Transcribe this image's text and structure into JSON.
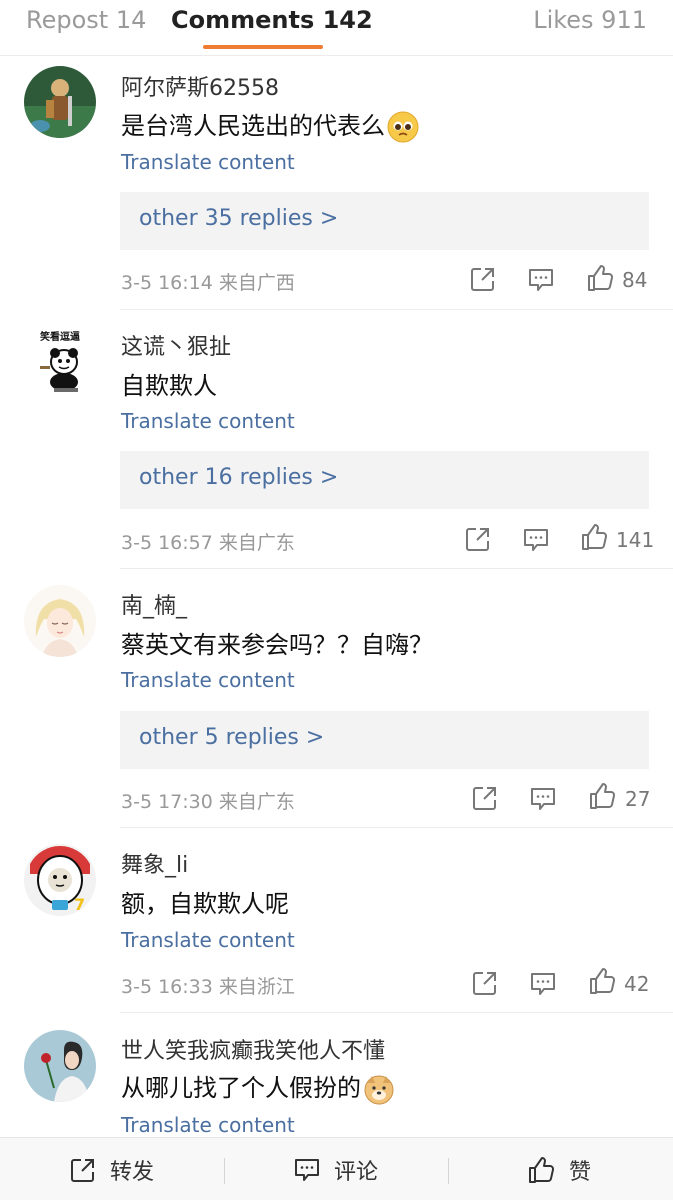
{
  "tabs": {
    "repost": "Repost 14",
    "comments": "Comments 142",
    "likes": "Likes 911"
  },
  "comments": [
    {
      "username": "阿尔萨斯62558",
      "text": "是台湾人民选出的代表么",
      "emoji": "pleading-face",
      "translate": "Translate content",
      "replies": "other 35 replies >",
      "meta": "3-5 16:14  来自广西",
      "likes": "84"
    },
    {
      "username": "这谎丶狠扯",
      "text": "自欺欺人",
      "avatar_caption": "笑看逗逼",
      "translate": "Translate content",
      "replies": "other 16 replies >",
      "meta": "3-5 16:57  来自广东",
      "likes": "141"
    },
    {
      "username": "南_楠_",
      "text": "蔡英文有来参会吗？？自嗨？",
      "translate": "Translate content",
      "replies": "other 5 replies >",
      "meta": "3-5 17:30  来自广东",
      "likes": "27"
    },
    {
      "username": "舞象_li",
      "text": "额，自欺欺人呢",
      "translate": "Translate content",
      "meta": "3-5 16:33  来自浙江",
      "likes": "42"
    },
    {
      "username": "世人笑我疯癫我笑他人不懂",
      "text": "从哪儿找了个人假扮的",
      "emoji": "doge",
      "translate": "Translate content"
    }
  ],
  "bottom_bar": {
    "repost": "转发",
    "comment": "评论",
    "like": "赞"
  },
  "colors": {
    "accent": "#ee7d33",
    "link": "#4a6fa0",
    "meta": "#999999"
  }
}
